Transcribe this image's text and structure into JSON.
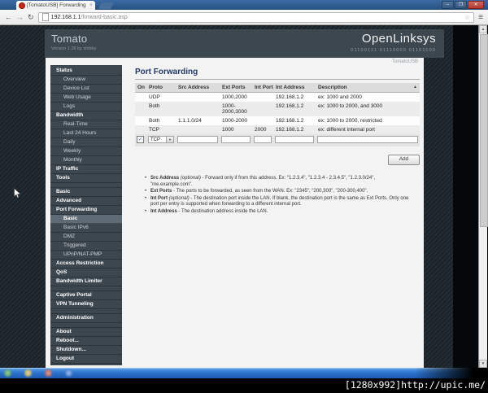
{
  "browser": {
    "tab_title": "[TomatoUSB] Forwarding",
    "url_host": "192.168.1.1",
    "url_path": "/forward-basic.asp"
  },
  "icons": {
    "back": "←",
    "forward": "→",
    "reload": "↻",
    "star": "☆",
    "menu": "≡",
    "tab_close": "×",
    "min": "–",
    "max": "❐",
    "close": "✕",
    "scroll_up": "▲",
    "scroll_down": "▼",
    "sort": "▲",
    "dropdown": "▼",
    "check": "✓"
  },
  "header": {
    "brand": "Tomato",
    "version": "Version 1.28 by shibby",
    "logo": "OpenLinksys",
    "logo_binary": "01100111 01110000 01101100",
    "corner_label": "TomatoUSB"
  },
  "sidebar": {
    "items": [
      {
        "label": "Status",
        "type": "header"
      },
      {
        "label": "Overview",
        "type": "sub"
      },
      {
        "label": "Device List",
        "type": "sub"
      },
      {
        "label": "Web Usage",
        "type": "sub"
      },
      {
        "label": "Logs",
        "type": "sub"
      },
      {
        "label": "Bandwidth",
        "type": "header"
      },
      {
        "label": "Real-Time",
        "type": "sub"
      },
      {
        "label": "Last 24 Hours",
        "type": "sub"
      },
      {
        "label": "Daily",
        "type": "sub"
      },
      {
        "label": "Weekly",
        "type": "sub"
      },
      {
        "label": "Monthly",
        "type": "sub"
      },
      {
        "label": "IP Traffic",
        "type": "header"
      },
      {
        "label": "Tools",
        "type": "header"
      },
      {
        "label": "Basic",
        "type": "header"
      },
      {
        "label": "Advanced",
        "type": "header"
      },
      {
        "label": "Port Forwarding",
        "type": "header"
      },
      {
        "label": "Basic",
        "type": "sub",
        "selected": true
      },
      {
        "label": "Basic IPv6",
        "type": "sub"
      },
      {
        "label": "DMZ",
        "type": "sub"
      },
      {
        "label": "Triggered",
        "type": "sub"
      },
      {
        "label": "UPnP/NAT-PMP",
        "type": "sub"
      },
      {
        "label": "Access Restriction",
        "type": "header"
      },
      {
        "label": "QoS",
        "type": "header"
      },
      {
        "label": "Bandwidth Limiter",
        "type": "header"
      },
      {
        "label": "Captive Portal",
        "type": "header"
      },
      {
        "label": "VPN Tunneling",
        "type": "header"
      },
      {
        "label": "Administration",
        "type": "header"
      },
      {
        "label": "About",
        "type": "header"
      },
      {
        "label": "Reboot...",
        "type": "header"
      },
      {
        "label": "Shutdown...",
        "type": "header"
      },
      {
        "label": "Logout",
        "type": "header"
      }
    ]
  },
  "main": {
    "title": "Port Forwarding",
    "table": {
      "columns": [
        "On",
        "Proto",
        "Src Address",
        "Ext Ports",
        "Int Port",
        "Int Address",
        "Description"
      ],
      "rows": [
        {
          "on": "",
          "proto": "UDP",
          "src": "",
          "ext": "1000,2000",
          "int_port": "",
          "int_addr": "192.168.1.2",
          "desc": "ex: 1000 and 2000"
        },
        {
          "on": "",
          "proto": "Both",
          "src": "",
          "ext": "1000-2000,3000",
          "int_port": "",
          "int_addr": "192.168.1.2",
          "desc": "ex: 1000 to 2000, and 3000"
        },
        {
          "on": "",
          "proto": "Both",
          "src": "1.1.1.0/24",
          "ext": "1000-2000",
          "int_port": "",
          "int_addr": "192.168.1.2",
          "desc": "ex: 1000 to 2000, restricted"
        },
        {
          "on": "",
          "proto": "TCP",
          "src": "",
          "ext": "1000",
          "int_port": "2000",
          "int_addr": "192.168.1.2",
          "desc": "ex: different internal port"
        }
      ],
      "editor": {
        "proto_selected": "TCP"
      }
    },
    "add_button": "Add",
    "notes": [
      {
        "term": "Src Address",
        "optional": "(optional)",
        "text": "- Forward only if from this address. Ex: \"1.2.3.4\", \"1.2.3.4 - 2.3.4.5\", \"1.2.3.0/24\", \"me.example.com\"."
      },
      {
        "term": "Ext Ports",
        "optional": "",
        "text": "- The ports to be forwarded, as seen from the WAN. Ex: \"2345\", \"200,300\", \"200-300,400\"."
      },
      {
        "term": "Int Port",
        "optional": "(optional)",
        "text": "- The destination port inside the LAN. If blank, the destination port is the same as Ext Ports. Only one port per entry is supported when forwarding to a different internal port."
      },
      {
        "term": "Int Address",
        "optional": "",
        "text": "- The destination address inside the LAN."
      }
    ]
  },
  "caption": "[1280x992]http://upic.me/"
}
